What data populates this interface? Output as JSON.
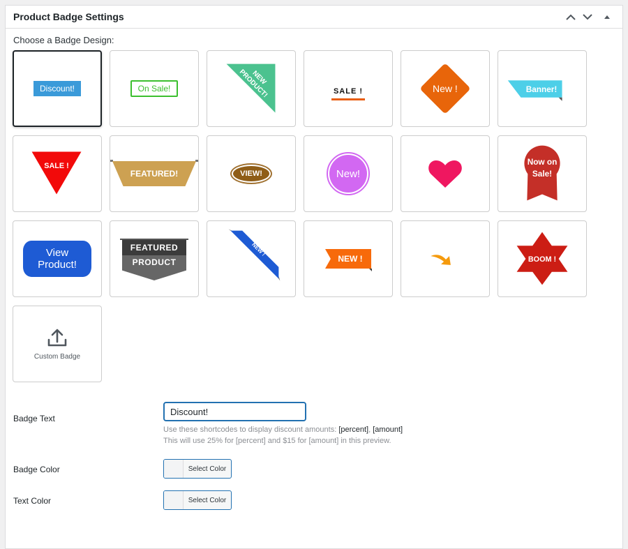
{
  "panel": {
    "title": "Product Badge Settings",
    "controls": [
      {
        "name": "move-up-button",
        "icon": "chevron-up-icon"
      },
      {
        "name": "move-down-button",
        "icon": "chevron-down-icon"
      },
      {
        "name": "toggle-panel-button",
        "icon": "triangle-up-icon"
      }
    ]
  },
  "chooser": {
    "label": "Choose a Badge Design:",
    "selected_index": 0,
    "badges": [
      {
        "id": "discount",
        "text": "Discount!",
        "color": "#3a9ad9"
      },
      {
        "id": "on-sale",
        "text": "On Sale!",
        "color": "#3bbf2e"
      },
      {
        "id": "new-product-corner",
        "text_line1": "NEW",
        "text_line2": "PRODUCT!",
        "color": "#4bc28f"
      },
      {
        "id": "sale-underline",
        "text": "SALE !",
        "color": "#e85d10"
      },
      {
        "id": "new-diamond",
        "text": "New !",
        "color": "#e8650a"
      },
      {
        "id": "banner",
        "text": "Banner!",
        "color": "#4dcfe8"
      },
      {
        "id": "sale-triangle",
        "text": "SALE !",
        "color": "#f20a0a"
      },
      {
        "id": "featured-ribbon",
        "text": "FEATURED!",
        "color": "#cda152"
      },
      {
        "id": "view-oval",
        "text": "VIEW!",
        "color": "#8f5d17"
      },
      {
        "id": "new-circle",
        "text": "New!",
        "color": "#d268f2"
      },
      {
        "id": "heart",
        "text": "",
        "color": "#ef1760"
      },
      {
        "id": "now-on-sale-rosette",
        "text_line1": "Now on",
        "text_line2": "Sale!",
        "color": "#c42f28"
      },
      {
        "id": "view-product",
        "text_line1": "View",
        "text_line2": "Product!",
        "color": "#1e5bd4"
      },
      {
        "id": "featured-product",
        "text_line1": "FEATURED",
        "text_line2": "PRODUCT",
        "color": "#3b3b3b"
      },
      {
        "id": "new-corner-ribbon",
        "text": "NEW !",
        "color": "#1e5bd4"
      },
      {
        "id": "new-flag",
        "text": "NEW !",
        "color": "#f76a0b"
      },
      {
        "id": "arrow",
        "text": "",
        "color": "#f59a0c"
      },
      {
        "id": "boom-star",
        "text": "BOOM !",
        "color": "#cc1d14"
      }
    ],
    "custom": {
      "label": "Custom Badge",
      "icon": "upload-icon"
    }
  },
  "form": {
    "badge_text": {
      "label": "Badge Text",
      "value": "Discount!",
      "help_prefix": "Use these shortcodes to display discount amounts: ",
      "shortcode_percent": "[percent]",
      "help_sep": ", ",
      "shortcode_amount": "[amount]",
      "help_line2": "This will use 25% for [percent] and $15 for [amount] in this preview."
    },
    "badge_color": {
      "label": "Badge Color",
      "button_label": "Select Color"
    },
    "text_color": {
      "label": "Text Color",
      "button_label": "Select Color"
    }
  }
}
